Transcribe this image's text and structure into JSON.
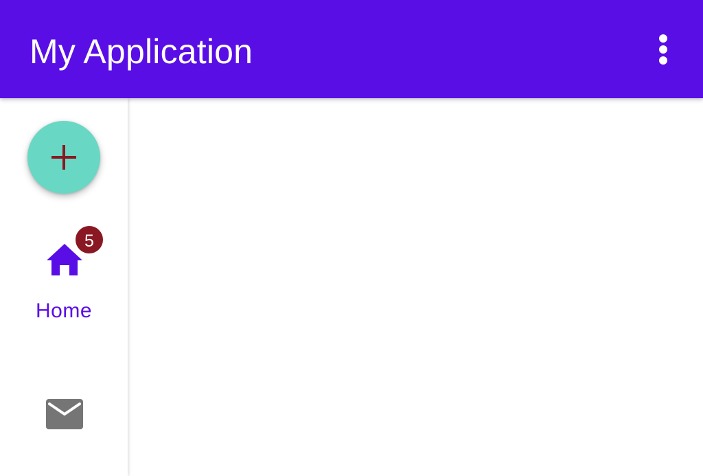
{
  "app_bar": {
    "title": "My Application",
    "overflow_icon": "more-vert-icon",
    "background_color": "#5a0ee6"
  },
  "rail": {
    "fab": {
      "icon": "add-icon",
      "background_color": "#68d8c4",
      "icon_color": "#8a1822"
    },
    "items": [
      {
        "label": "Home",
        "icon": "home-icon",
        "badge": "5",
        "selected": true,
        "color": "#5a0ee6"
      },
      {
        "label": "",
        "icon": "mail-icon",
        "selected": false,
        "color": "#757575"
      }
    ],
    "badge_color": "#8a1822"
  }
}
